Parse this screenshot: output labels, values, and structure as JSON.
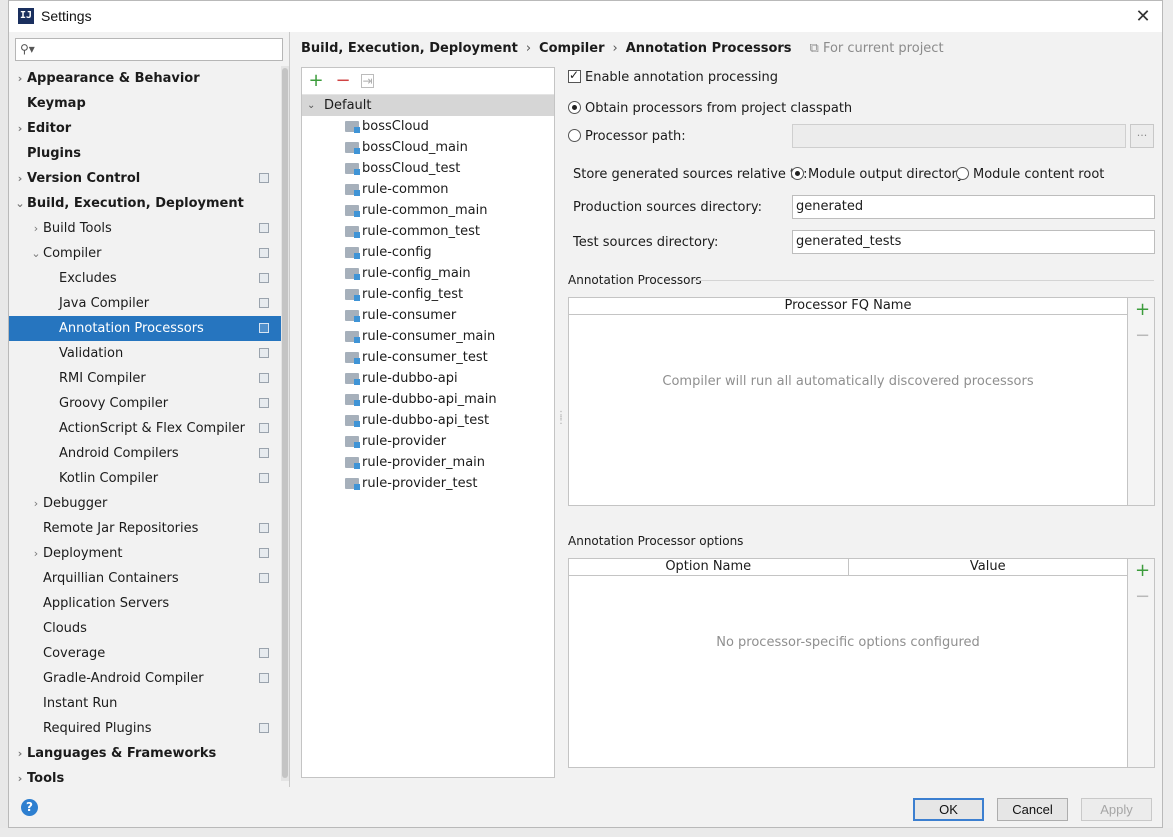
{
  "window": {
    "title": "Settings",
    "app_icon": "IJ"
  },
  "search": {
    "value": "",
    "placeholder": ""
  },
  "nav": {
    "items": [
      {
        "label": "Appearance & Behavior",
        "level": 0,
        "arrow": "right",
        "bold": true,
        "project": false,
        "selected": false
      },
      {
        "label": "Keymap",
        "level": 0,
        "arrow": "none",
        "bold": true,
        "project": false,
        "selected": false
      },
      {
        "label": "Editor",
        "level": 0,
        "arrow": "right",
        "bold": true,
        "project": false,
        "selected": false
      },
      {
        "label": "Plugins",
        "level": 0,
        "arrow": "none",
        "bold": true,
        "project": false,
        "selected": false
      },
      {
        "label": "Version Control",
        "level": 0,
        "arrow": "right",
        "bold": true,
        "project": true,
        "selected": false
      },
      {
        "label": "Build, Execution, Deployment",
        "level": 0,
        "arrow": "down",
        "bold": true,
        "project": false,
        "selected": false
      },
      {
        "label": "Build Tools",
        "level": 1,
        "arrow": "right",
        "bold": false,
        "project": true,
        "selected": false
      },
      {
        "label": "Compiler",
        "level": 1,
        "arrow": "down",
        "bold": false,
        "project": true,
        "selected": false
      },
      {
        "label": "Excludes",
        "level": 2,
        "arrow": "none",
        "bold": false,
        "project": true,
        "selected": false
      },
      {
        "label": "Java Compiler",
        "level": 2,
        "arrow": "none",
        "bold": false,
        "project": true,
        "selected": false
      },
      {
        "label": "Annotation Processors",
        "level": 2,
        "arrow": "none",
        "bold": false,
        "project": true,
        "selected": true
      },
      {
        "label": "Validation",
        "level": 2,
        "arrow": "none",
        "bold": false,
        "project": true,
        "selected": false
      },
      {
        "label": "RMI Compiler",
        "level": 2,
        "arrow": "none",
        "bold": false,
        "project": true,
        "selected": false
      },
      {
        "label": "Groovy Compiler",
        "level": 2,
        "arrow": "none",
        "bold": false,
        "project": true,
        "selected": false
      },
      {
        "label": "ActionScript & Flex Compiler",
        "level": 2,
        "arrow": "none",
        "bold": false,
        "project": true,
        "selected": false
      },
      {
        "label": "Android Compilers",
        "level": 2,
        "arrow": "none",
        "bold": false,
        "project": true,
        "selected": false
      },
      {
        "label": "Kotlin Compiler",
        "level": 2,
        "arrow": "none",
        "bold": false,
        "project": true,
        "selected": false
      },
      {
        "label": "Debugger",
        "level": 1,
        "arrow": "right",
        "bold": false,
        "project": false,
        "selected": false
      },
      {
        "label": "Remote Jar Repositories",
        "level": 1,
        "arrow": "none",
        "bold": false,
        "project": true,
        "selected": false
      },
      {
        "label": "Deployment",
        "level": 1,
        "arrow": "right",
        "bold": false,
        "project": true,
        "selected": false
      },
      {
        "label": "Arquillian Containers",
        "level": 1,
        "arrow": "none",
        "bold": false,
        "project": true,
        "selected": false
      },
      {
        "label": "Application Servers",
        "level": 1,
        "arrow": "none",
        "bold": false,
        "project": false,
        "selected": false
      },
      {
        "label": "Clouds",
        "level": 1,
        "arrow": "none",
        "bold": false,
        "project": false,
        "selected": false
      },
      {
        "label": "Coverage",
        "level": 1,
        "arrow": "none",
        "bold": false,
        "project": true,
        "selected": false
      },
      {
        "label": "Gradle-Android Compiler",
        "level": 1,
        "arrow": "none",
        "bold": false,
        "project": true,
        "selected": false
      },
      {
        "label": "Instant Run",
        "level": 1,
        "arrow": "none",
        "bold": false,
        "project": false,
        "selected": false
      },
      {
        "label": "Required Plugins",
        "level": 1,
        "arrow": "none",
        "bold": false,
        "project": true,
        "selected": false
      },
      {
        "label": "Languages & Frameworks",
        "level": 0,
        "arrow": "right",
        "bold": true,
        "project": false,
        "selected": false
      },
      {
        "label": "Tools",
        "level": 0,
        "arrow": "right",
        "bold": true,
        "project": false,
        "selected": false
      }
    ]
  },
  "breadcrumb": {
    "parts": [
      "Build, Execution, Deployment",
      "Compiler",
      "Annotation Processors"
    ],
    "separator": "›",
    "scope": "For current project"
  },
  "profiles": {
    "root": "Default",
    "modules": [
      "bossCloud",
      "bossCloud_main",
      "bossCloud_test",
      "rule-common",
      "rule-common_main",
      "rule-common_test",
      "rule-config",
      "rule-config_main",
      "rule-config_test",
      "rule-consumer",
      "rule-consumer_main",
      "rule-consumer_test",
      "rule-dubbo-api",
      "rule-dubbo-api_main",
      "rule-dubbo-api_test",
      "rule-provider",
      "rule-provider_main",
      "rule-provider_test"
    ]
  },
  "settings": {
    "enable_label": "Enable annotation processing",
    "enable_checked": true,
    "obtain_label": "Obtain processors from project classpath",
    "obtain_selected": true,
    "processor_path_label": "Processor path:",
    "processor_path_value": "",
    "browse_label": "...",
    "store_label": "Store generated sources relative to:",
    "module_output_label": "Module output directory",
    "module_output_selected": true,
    "module_content_label": "Module content root",
    "production_label": "Production sources directory:",
    "production_value": "generated",
    "test_label": "Test sources directory:",
    "test_value": "generated_tests"
  },
  "processors_section": {
    "title": "Annotation Processors",
    "column": "Processor FQ Name",
    "empty_text": "Compiler will run all automatically discovered processors"
  },
  "options_section": {
    "title": "Annotation Processor options",
    "columns": [
      "Option Name",
      "Value"
    ],
    "empty_text": "No processor-specific options configured"
  },
  "buttons": {
    "ok": "OK",
    "cancel": "Cancel",
    "apply": "Apply",
    "help": "?"
  },
  "colors": {
    "selection": "#2675bf",
    "add": "#3c9c3c",
    "remove": "#d04343",
    "help": "#2d7fd0"
  }
}
